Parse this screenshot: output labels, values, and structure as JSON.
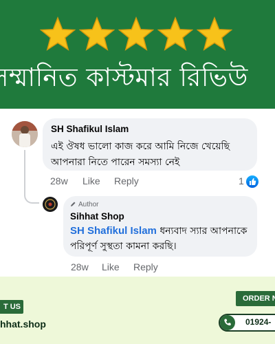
{
  "banner": {
    "title": "সম্মানিত কাস্টমার রিভিউ",
    "star_count": 5,
    "star_color": "#f7c21a",
    "background": "#1f7a3c"
  },
  "comment": {
    "author": "SH Shafikul Islam",
    "text": "এই ঔষধ ভালো কাজ করে আমি নিজে খেয়েছি আপনারা নিতে পারেন সমস্যা নেই",
    "time": "28w",
    "like_label": "Like",
    "reply_label": "Reply",
    "reaction_count": "1",
    "reaction_icon": "thumbs-up-icon"
  },
  "reply": {
    "badge": "Author",
    "author": "Sihhat Shop",
    "mention": "SH Shafikul Islam",
    "text": "ধন্যবাদ স্যার আপনাকে পরিপূর্ণ সুস্থতা কামনা করছি।",
    "time": "28w",
    "like_label": "Like",
    "reply_label": "Reply"
  },
  "footer": {
    "contact_label": "T US",
    "website": "hhat.shop",
    "order_label": "ORDER N",
    "phone": "01924-",
    "phone_icon": "phone-icon",
    "background": "#eef8d9",
    "accent": "#2a6b39"
  }
}
